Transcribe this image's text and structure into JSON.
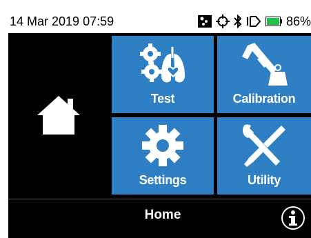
{
  "status_bar": {
    "datetime": "14 Mar 2019 07:59",
    "icons": [
      "image-icon",
      "gps-icon",
      "bluetooth-icon",
      "usb-icon",
      "battery-icon"
    ],
    "battery_percent": "86%"
  },
  "home_panel": {
    "icon": "home-icon"
  },
  "tiles": [
    {
      "label": "Test",
      "icon": "test-icon"
    },
    {
      "label": "Calibration",
      "icon": "calibration-icon"
    },
    {
      "label": "Settings",
      "icon": "gear-icon"
    },
    {
      "label": "Utility",
      "icon": "tools-icon"
    }
  ],
  "bottom_bar": {
    "title": "Home",
    "info_icon": "info-icon"
  },
  "colors": {
    "tile": "#2f7fc4",
    "background": "#000000",
    "status_bar": "#ffffff",
    "battery_fill": "#22c04a"
  }
}
